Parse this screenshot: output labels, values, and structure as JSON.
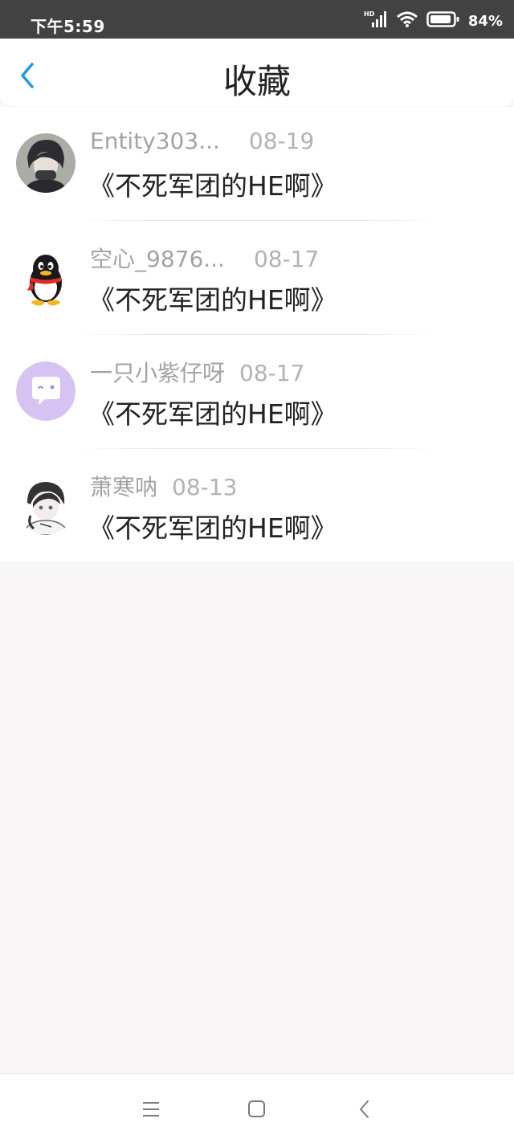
{
  "status_bar": {
    "time": "下午5:59",
    "network": "HD",
    "battery": "84%",
    "icons": [
      "signal-icon",
      "wifi-icon",
      "battery-icon"
    ]
  },
  "header": {
    "title": "收藏",
    "back_icon": "chevron-left-icon",
    "accent_color": "#1e9be8"
  },
  "favorites": [
    {
      "user": "Entity303...",
      "date": "08-19",
      "title": "《不死军团的HE啊》",
      "avatar": "anime-dark-hair-avatar"
    },
    {
      "user": "空心_9876...",
      "date": "08-17",
      "title": "《不死军团的HE啊》",
      "avatar": "qq-penguin-avatar"
    },
    {
      "user": "一只小紫仔呀",
      "date": "08-17",
      "title": "《不死军团的HE啊》",
      "avatar": "purple-chat-bubble-avatar"
    },
    {
      "user": "萧寒呐",
      "date": "08-13",
      "title": "《不死军团的HE啊》",
      "avatar": "anime-boy-sketch-avatar"
    }
  ],
  "nav_bar": {
    "buttons": [
      "menu-icon",
      "home-square-icon",
      "back-triangle-icon"
    ]
  }
}
